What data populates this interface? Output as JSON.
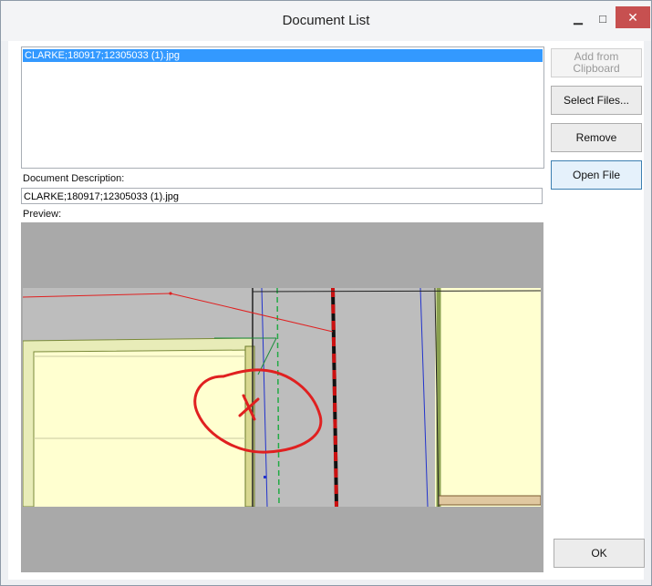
{
  "window": {
    "title": "Document List"
  },
  "title_controls": {
    "minimize": "▁",
    "maximize": "□",
    "close": "✕"
  },
  "document_list": {
    "items": [
      "CLARKE;180917;12305033 (1).jpg"
    ]
  },
  "description": {
    "label": "Document Description:",
    "value": "CLARKE;180917;12305033 (1).jpg"
  },
  "preview": {
    "label": "Preview:"
  },
  "buttons": {
    "add_from_clipboard": "Add from Clipboard",
    "select_files": "Select Files...",
    "remove": "Remove",
    "open_file": "Open File",
    "ok": "OK"
  },
  "colors": {
    "selection": "#3399ff",
    "annotation": "#e02020",
    "parcel_fill": "#ffffd0"
  }
}
